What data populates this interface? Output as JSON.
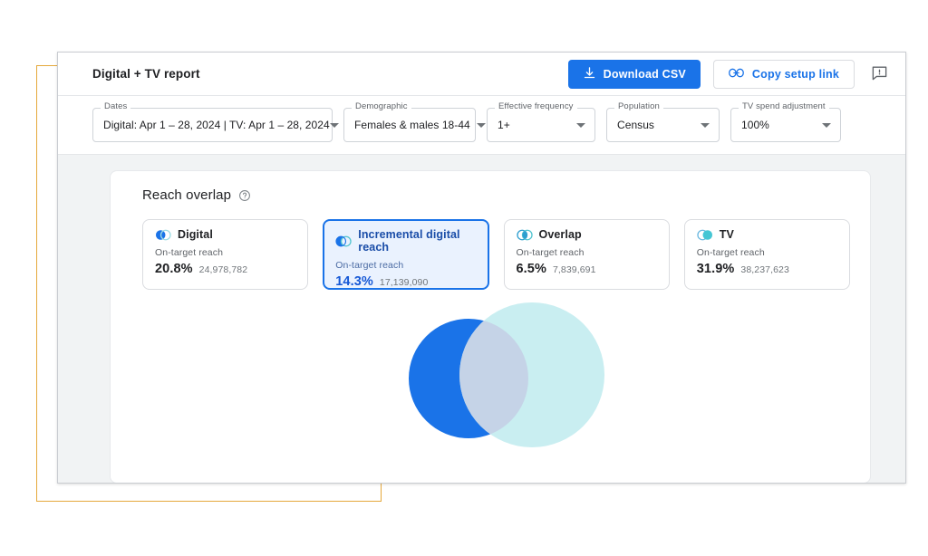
{
  "window": {
    "header": {
      "title": "Digital + TV report",
      "download_button": "Download CSV",
      "copy_button": "Copy setup link",
      "feedback_icon": "feedback-icon"
    },
    "filters": [
      {
        "label": "Dates",
        "value": "Digital: Apr 1 – 28, 2024 | TV: Apr 1 – 28, 2024"
      },
      {
        "label": "Demographic",
        "value": "Females & males 18-44"
      },
      {
        "label": "Effective frequency",
        "value": "1+"
      },
      {
        "label": "Population",
        "value": "Census"
      },
      {
        "label": "TV spend adjustment",
        "value": "100%"
      }
    ]
  },
  "panel": {
    "title": "Reach overlap",
    "help_icon": "help-icon",
    "metric_sub_label": "On-target reach",
    "cards": [
      {
        "name": "Digital",
        "sub": "On-target reach",
        "pct": "20.8%",
        "abs": "24,978,782",
        "selected": false,
        "icon": "venn-left-filled-icon"
      },
      {
        "name": "Incremental digital reach",
        "sub": "On-target reach",
        "pct": "14.3%",
        "abs": "17,139,090",
        "selected": true,
        "icon": "venn-left-crescent-icon"
      },
      {
        "name": "Overlap",
        "sub": "On-target reach",
        "pct": "6.5%",
        "abs": "7,839,691",
        "selected": false,
        "icon": "venn-intersection-icon"
      },
      {
        "name": "TV",
        "sub": "On-target reach",
        "pct": "31.9%",
        "abs": "38,237,623",
        "selected": false,
        "icon": "venn-right-filled-icon"
      }
    ]
  },
  "colors": {
    "digital_blue": "#1a73e8",
    "tv_teal": "#c9eef1",
    "overlap": "#c5d3e7",
    "accent_frame": "#e5a83b",
    "selected_card_bg": "#eaf2fe"
  },
  "chart_data": {
    "type": "venn",
    "title": "Reach overlap",
    "sets": [
      {
        "name": "Digital",
        "pct": 20.8,
        "value": 24978782,
        "color": "#1a73e8"
      },
      {
        "name": "TV",
        "pct": 31.9,
        "value": 38237623,
        "color": "#c9eef1"
      }
    ],
    "intersection": {
      "name": "Overlap",
      "pct": 6.5,
      "value": 7839691,
      "color": "#c5d3e7"
    },
    "exclusive": {
      "name": "Incremental digital reach",
      "pct": 14.3,
      "value": 17139090
    }
  }
}
